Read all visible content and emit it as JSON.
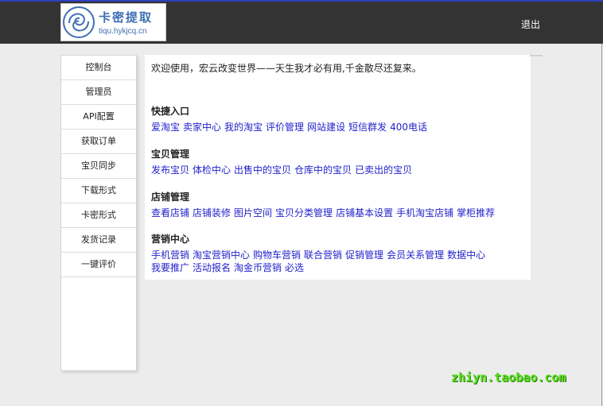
{
  "header": {
    "logo_title": "卡密提取",
    "logo_url": "tiqu.hykjcq.cn",
    "logout_label": "退出",
    "accent_color": "#2f3fbf",
    "bar_color": "#333333"
  },
  "sidebar": {
    "items": [
      {
        "label": "控制台"
      },
      {
        "label": "管理员"
      },
      {
        "label": "API配置"
      },
      {
        "label": "获取订单"
      },
      {
        "label": "宝贝同步"
      },
      {
        "label": "下载形式"
      },
      {
        "label": "卡密形式"
      },
      {
        "label": "发货记录"
      },
      {
        "label": "一键评价"
      }
    ]
  },
  "main": {
    "welcome": "欢迎使用，宏云改变世界——天生我才必有用,千金散尽还复来。",
    "sections": [
      {
        "title": "快捷入口",
        "links": [
          "爱淘宝",
          "卖家中心",
          "我的淘宝",
          "评价管理",
          "网站建设",
          "短信群发",
          "400电话"
        ]
      },
      {
        "title": "宝贝管理",
        "links": [
          "发布宝贝",
          "体检中心",
          "出售中的宝贝",
          "仓库中的宝贝",
          "已卖出的宝贝"
        ]
      },
      {
        "title": "店铺管理",
        "links": [
          "查看店铺",
          "店铺装修",
          "图片空间",
          "宝贝分类管理",
          "店铺基本设置",
          "手机淘宝店铺",
          "掌柜推荐"
        ]
      },
      {
        "title": "营销中心",
        "links": [
          "手机营销",
          "淘宝营销中心",
          "购物车营销",
          "联合营销",
          "促销管理",
          "会员关系管理",
          "数据中心"
        ],
        "links_row2": [
          "我要推广",
          "活动报名",
          "淘金币营销",
          "必选"
        ]
      }
    ],
    "link_color": "#2222cc"
  },
  "watermark": "zhiyn.taobao.com"
}
